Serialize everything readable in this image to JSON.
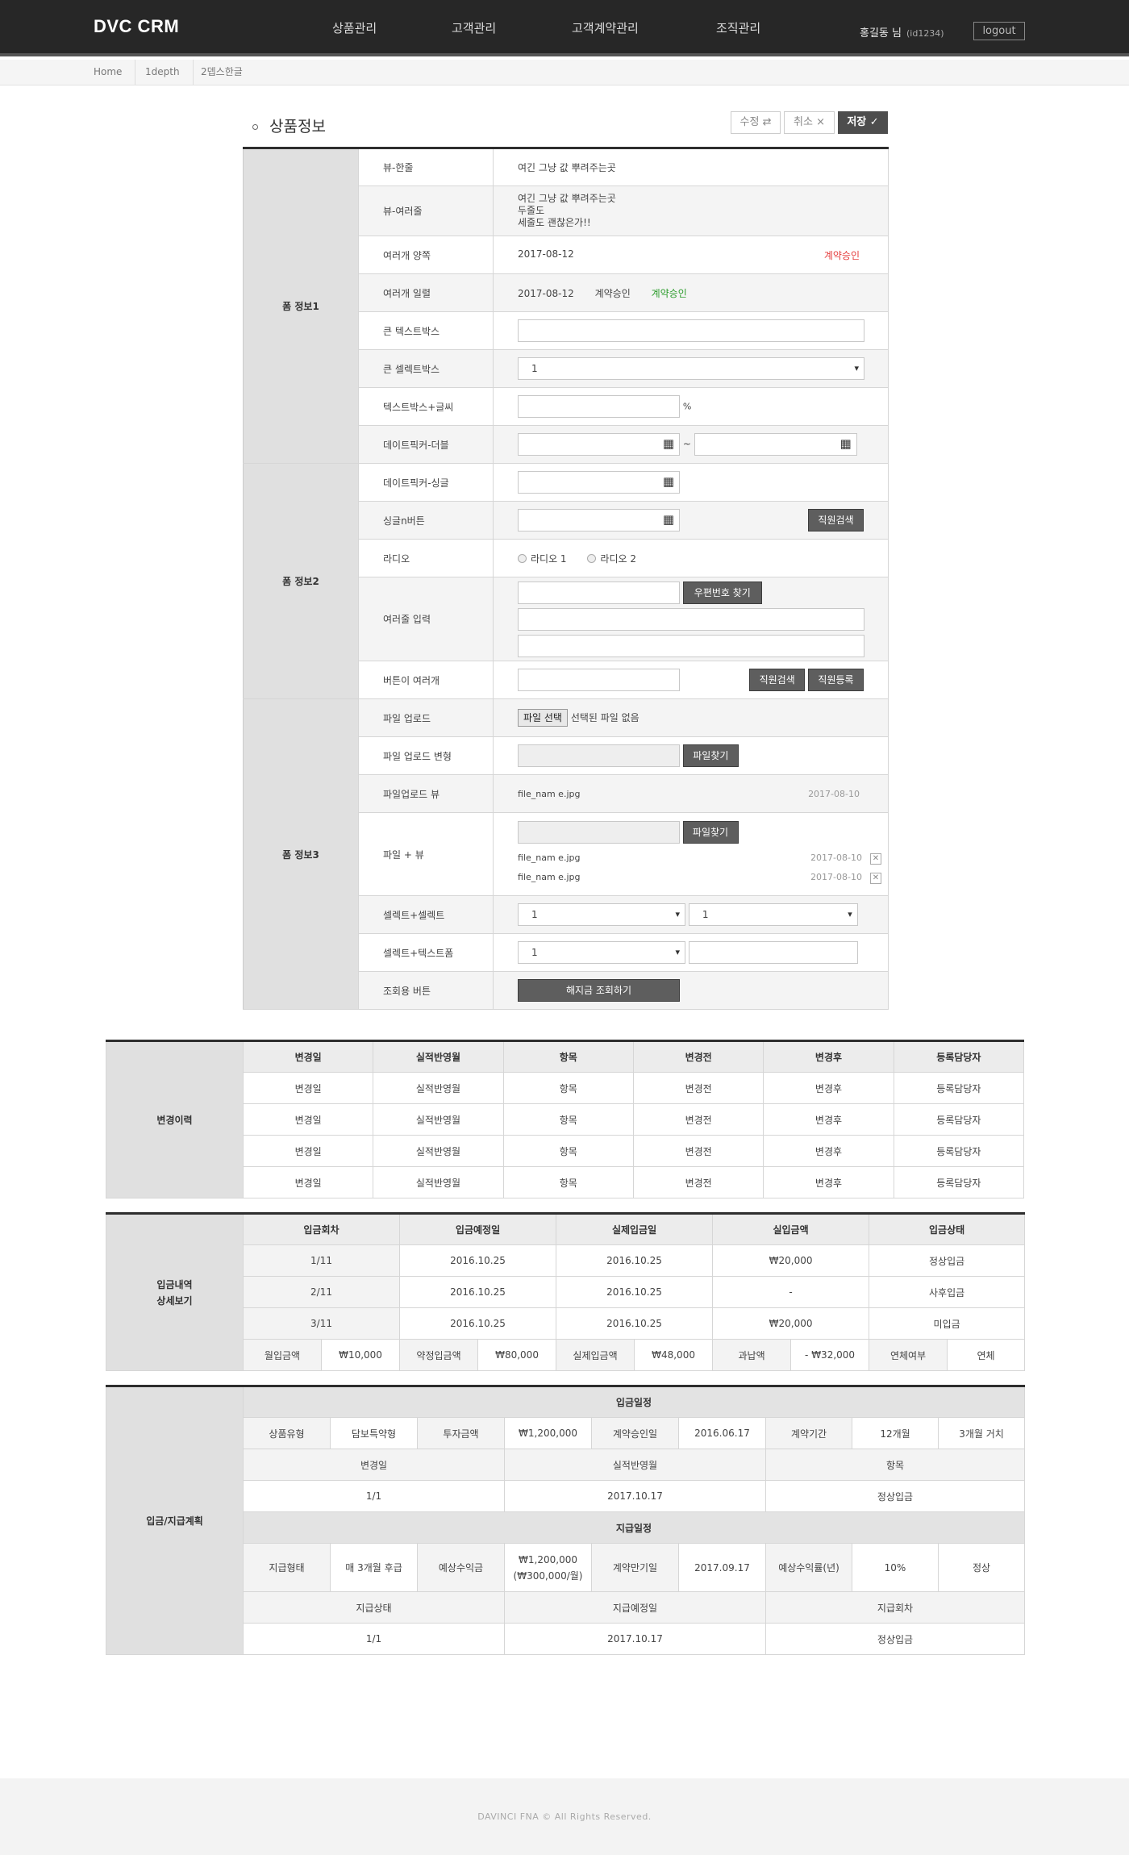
{
  "header": {
    "logo": "DVC CRM",
    "nav": [
      "상품관리",
      "고객관리",
      "고객계약관리",
      "조직관리"
    ],
    "user_name": "홍길동 님",
    "user_id": "(id1234)",
    "logout": "logout"
  },
  "breadcrumb": [
    "Home",
    "1depth",
    "2뎁스한글"
  ],
  "section": {
    "title": "상품정보",
    "edit_label": "수정",
    "edit_icon": "⇄",
    "cancel_label": "취소",
    "cancel_icon": "×",
    "save_label": "저장",
    "save_icon": "✓"
  },
  "form": {
    "group1": "폼 정보1",
    "group2": "폼 정보2",
    "group3": "폼 정보3",
    "r1": {
      "label": "뷰-한줄",
      "value": "여긴 그냥 값 뿌려주는곳"
    },
    "r2": {
      "label": "뷰-여러줄",
      "line1": "여긴 그냥 값 뿌려주는곳",
      "line2": "두줄도",
      "line3": "세줄도 괜찮은가!!"
    },
    "r3": {
      "label": "여러개 양쪽",
      "date": "2017-08-12",
      "status": "계약승인"
    },
    "r4": {
      "label": "여러개 일렬",
      "date": "2017-08-12",
      "text": "계약승인",
      "status": "계약승인"
    },
    "r5": {
      "label": "큰 텍스트박스"
    },
    "r6": {
      "label": "큰 셀렉트박스",
      "value": "1"
    },
    "r7": {
      "label": "텍스트박스+글씨",
      "unit": "%"
    },
    "r8": {
      "label": "데이트픽커-더블",
      "sep": "~"
    },
    "r9": {
      "label": "데이트픽커-싱글"
    },
    "r10": {
      "label": "싱글n버튼",
      "button": "직원검색"
    },
    "r11": {
      "label": "라디오",
      "opt1": "라디오 1",
      "opt2": "라디오 2"
    },
    "r12": {
      "label": "여러줄 입력",
      "button": "우편번호 찾기"
    },
    "r13": {
      "label": "버튼이 여러개",
      "button1": "직원검색",
      "button2": "직원등록"
    },
    "r14": {
      "label": "파일 업로드",
      "button": "파일 선택",
      "status": "선택된 파일 없음"
    },
    "r15": {
      "label": "파일 업로드 변형",
      "button": "파일찾기"
    },
    "r16": {
      "label": "파일업로드 뷰",
      "file": "file_nam e.jpg",
      "date": "2017-08-10"
    },
    "r17": {
      "label": "파일 + 뷰",
      "button": "파일찾기",
      "file1": "file_nam e.jpg",
      "date1": "2017-08-10",
      "file2": "file_nam e.jpg",
      "date2": "2017-08-10"
    },
    "r18": {
      "label": "셀렉트+셀렉트",
      "value1": "1",
      "value2": "1"
    },
    "r19": {
      "label": "셀렉트+텍스트폼",
      "value": "1"
    },
    "r20": {
      "label": "조회용 버튼",
      "button": "해지금 조회하기"
    }
  },
  "change_history": {
    "group": "변경이력",
    "headers": [
      "변경일",
      "실적반영월",
      "항목",
      "변경전",
      "변경후",
      "등록담당자"
    ],
    "rows": [
      [
        "변경일",
        "실적반영월",
        "항목",
        "변경전",
        "변경후",
        "등록담당자"
      ],
      [
        "변경일",
        "실적반영월",
        "항목",
        "변경전",
        "변경후",
        "등록담당자"
      ],
      [
        "변경일",
        "실적반영월",
        "항목",
        "변경전",
        "변경후",
        "등록담당자"
      ],
      [
        "변경일",
        "실적반영월",
        "항목",
        "변경전",
        "변경후",
        "등록담당자"
      ]
    ]
  },
  "deposit": {
    "group_line1": "입금내역",
    "group_line2": "상세보기",
    "headers": [
      "입금회차",
      "입금예정일",
      "실제입금일",
      "실입금액",
      "입금상태"
    ],
    "rows": [
      [
        "1/11",
        "2016.10.25",
        "2016.10.25",
        "₩20,000",
        "정상입금"
      ],
      [
        "2/11",
        "2016.10.25",
        "2016.10.25",
        "-",
        "사후입금"
      ],
      [
        "3/11",
        "2016.10.25",
        "2016.10.25",
        "₩20,000",
        "미입금"
      ]
    ],
    "summary": [
      "월입금액",
      "₩10,000",
      "약정입금액",
      "₩80,000",
      "실제입금액",
      "₩48,000",
      "과납액",
      "- ₩32,000",
      "연체여부",
      "연체"
    ],
    "colors": {
      "normal": "#2c9c2c",
      "unpaid": "#e53c3c"
    }
  },
  "plan": {
    "group": "입금/지급계획",
    "deposit_title": "입금일정",
    "deposit_info": [
      "상품유형",
      "담보특약형",
      "투자금액",
      "₩1,200,000",
      "계약승인일",
      "2016.06.17",
      "계약기간",
      "12개월",
      "3개월 거치"
    ],
    "deposit_sub_headers": [
      "변경일",
      "실적반영월",
      "항목"
    ],
    "deposit_sub_row": [
      "1/1",
      "2017.10.17",
      "정상입금"
    ],
    "pay_title": "지급일정",
    "pay_info": [
      "지급형태",
      "매 3개월 후급",
      "예상수익금",
      "₩1,200,000",
      "(₩300,000/월)",
      "계약만기일",
      "2017.09.17",
      "예상수익률(년)",
      "10%",
      "정상"
    ],
    "pay_sub_headers": [
      "지급상태",
      "지급예정일",
      "지급회차"
    ],
    "pay_sub_row": [
      "1/1",
      "2017.10.17",
      "정상입금"
    ]
  },
  "footer": "DAVINCI FNA © All Rights Reserved."
}
